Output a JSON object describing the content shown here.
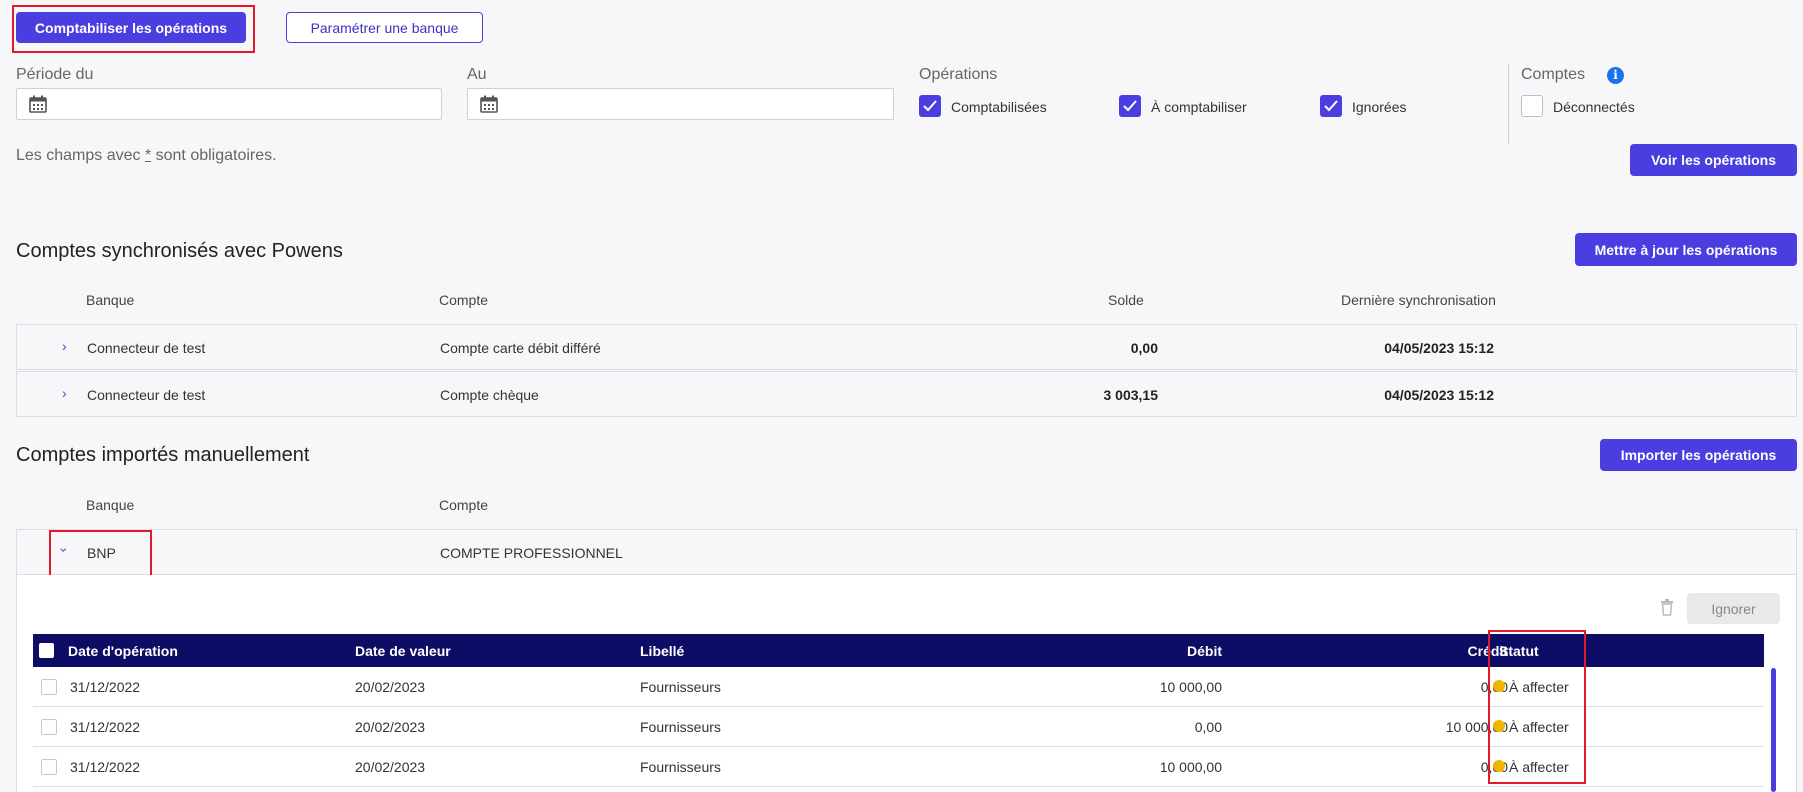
{
  "toolbar": {
    "post_label": "Comptabiliser les opérations",
    "configure_bank_label": "Paramétrer une banque"
  },
  "filters": {
    "period_from_label": "Période du",
    "period_to_label": "Au",
    "period_from_value": "",
    "period_to_value": "",
    "operations_label": "Opérations",
    "op_posted": {
      "label": "Comptabilisées",
      "checked": true
    },
    "op_to_post": {
      "label": "À comptabiliser",
      "checked": true
    },
    "op_ignored": {
      "label": "Ignorées",
      "checked": true
    },
    "accounts_label": "Comptes",
    "disconnected": {
      "label": "Déconnectés",
      "checked": false
    },
    "required_note_prefix": "Les champs avec ",
    "required_note_star": "*",
    "required_note_suffix": " sont obligatoires.",
    "view_operations_label": "Voir les opérations"
  },
  "synced": {
    "title": "Comptes synchronisés avec Powens",
    "update_label": "Mettre à jour les opérations",
    "headers": {
      "bank": "Banque",
      "account": "Compte",
      "balance": "Solde",
      "last_sync": "Dernière synchronisation"
    },
    "rows": [
      {
        "bank": "Connecteur de test",
        "account": "Compte carte débit différé",
        "balance": "0,00",
        "last_sync": "04/05/2023 15:12"
      },
      {
        "bank": "Connecteur de test",
        "account": "Compte chèque",
        "balance": "3 003,15",
        "last_sync": "04/05/2023 15:12"
      }
    ]
  },
  "manual": {
    "title": "Comptes importés manuellement",
    "import_label": "Importer les opérations",
    "headers": {
      "bank": "Banque",
      "account": "Compte"
    },
    "row": {
      "bank": "BNP",
      "account": "COMPTE PROFESSIONNEL"
    },
    "ignore_label": "Ignorer",
    "table": {
      "headers": {
        "op_date": "Date d'opération",
        "value_date": "Date de valeur",
        "label": "Libellé",
        "debit": "Débit",
        "credit": "Crédit",
        "status": "Statut"
      },
      "rows": [
        {
          "op_date": "31/12/2022",
          "value_date": "20/02/2023",
          "label": "Fournisseurs",
          "debit": "10 000,00",
          "credit": "0,00",
          "status": "À affecter"
        },
        {
          "op_date": "31/12/2022",
          "value_date": "20/02/2023",
          "label": "Fournisseurs",
          "debit": "0,00",
          "credit": "10 000,00",
          "status": "À affecter"
        },
        {
          "op_date": "31/12/2022",
          "value_date": "20/02/2023",
          "label": "Fournisseurs",
          "debit": "10 000,00",
          "credit": "0,00",
          "status": "À affecter"
        }
      ]
    }
  },
  "colors": {
    "accent": "#4a3ee0",
    "table_header": "#0e0d66",
    "highlight": "#e0192b",
    "status": "#f0b400"
  }
}
